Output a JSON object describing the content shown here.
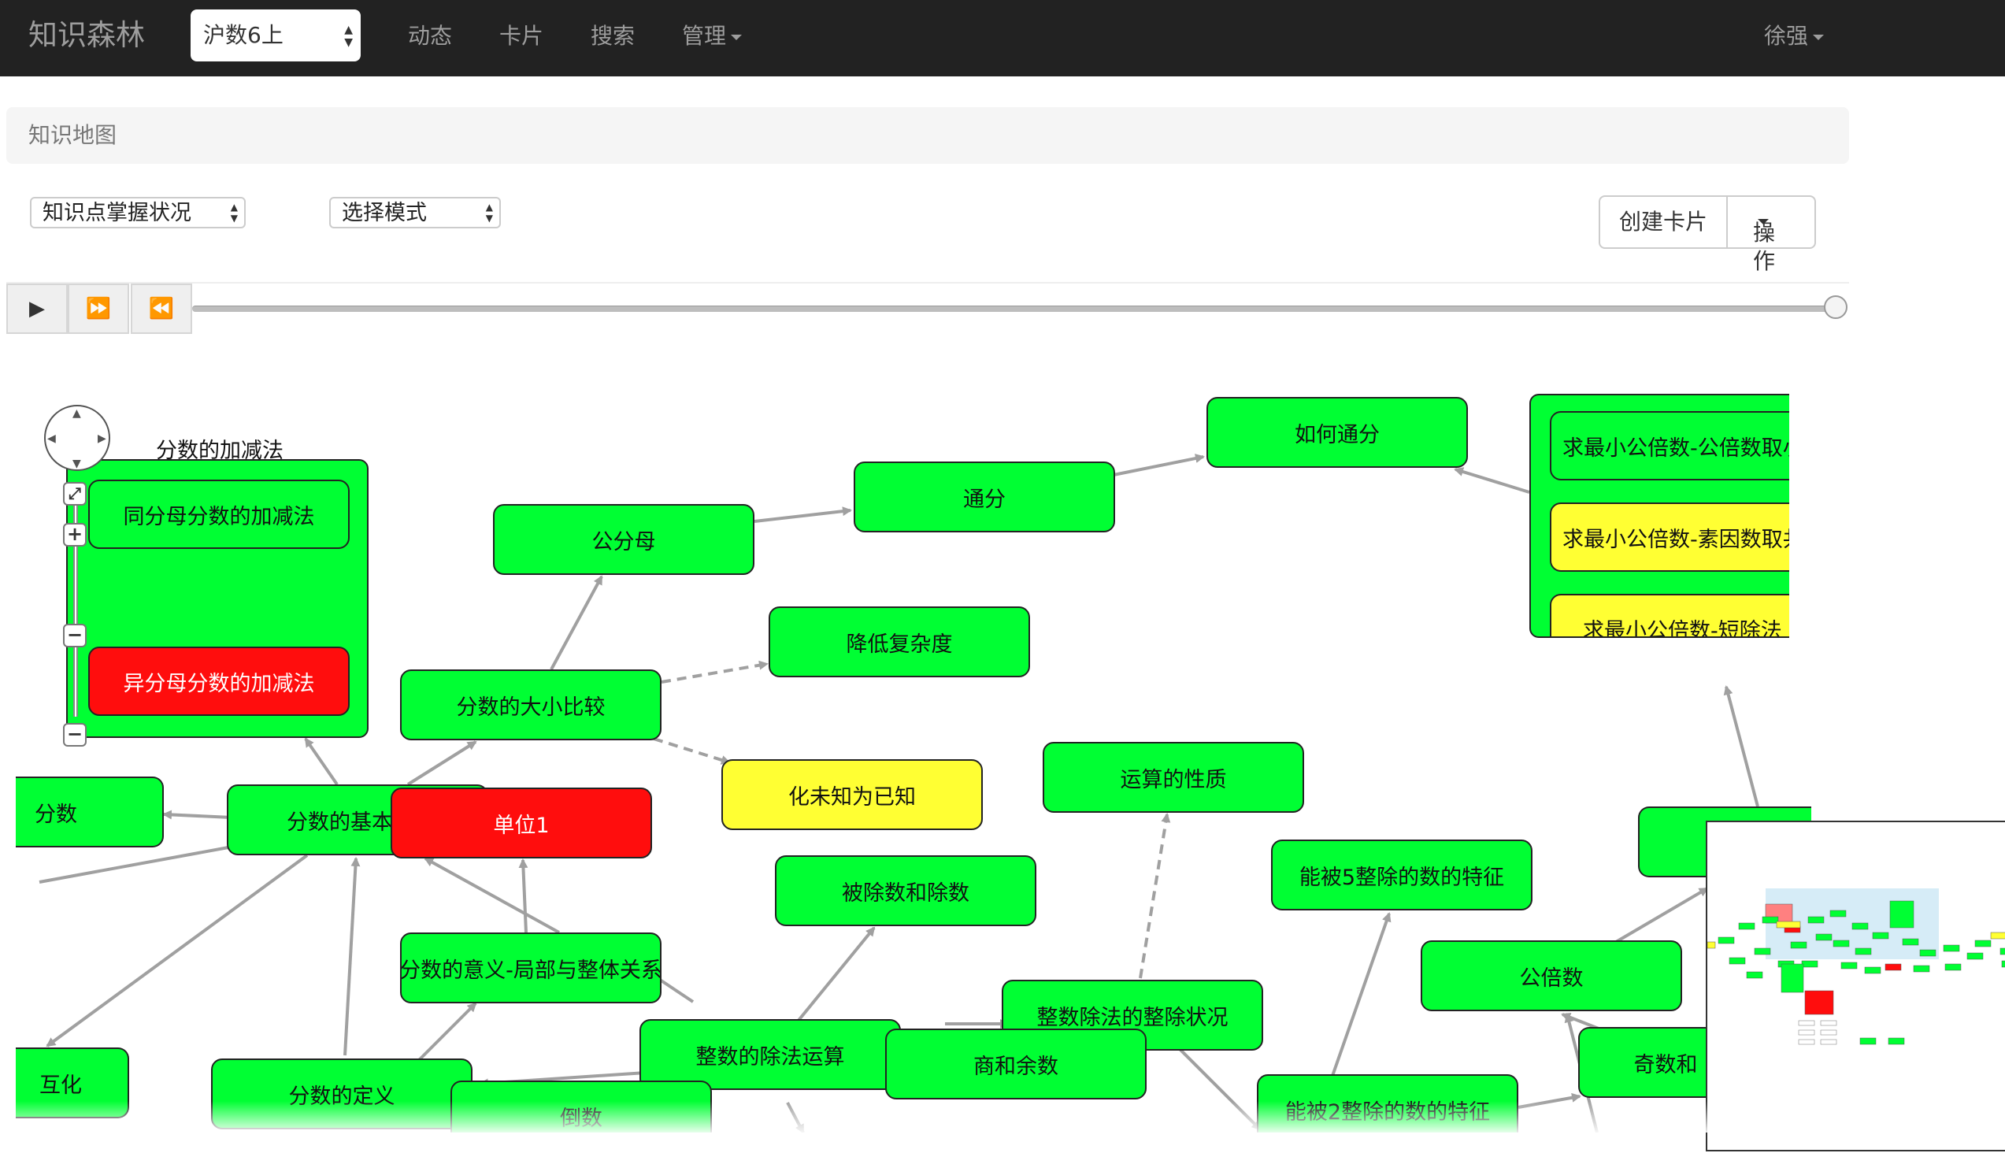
{
  "navbar": {
    "brand": "知识森林",
    "course_select": "沪数6上",
    "links": [
      "动态",
      "卡片",
      "搜索"
    ],
    "manage": "管理",
    "user": "徐强"
  },
  "breadcrumb": "知识地图",
  "controls": {
    "status_select": "知识点掌握状况",
    "mode_select": "选择模式",
    "create_card": "创建卡片",
    "actions": "操作"
  },
  "player": {
    "play_icon": "▶",
    "fast_forward_icon": "⏩",
    "rewind_icon": "⏪",
    "progress": 1.0
  },
  "colors": {
    "mastered": "#00ff33",
    "weak": "#ff0d0d",
    "partial": "#ffff33"
  },
  "graph": {
    "group_label": "分数的加减法",
    "nodes": {
      "same_denominator": "同分母分数的加减法",
      "diff_denominator": "异分母分数的加减法",
      "common_denominator": "公分母",
      "tongfen": "通分",
      "how_tongfen": "如何通分",
      "reduce_complexity": "降低复杂度",
      "compare_fractions": "分数的大小比较",
      "unknown_to_known": "化未知为已知",
      "unit_one": "单位1",
      "fraction_basic": "分数的基本",
      "fraction_left": "分数",
      "operation_props": "运算的性质",
      "dividend_divisor": "被除数和除数",
      "div_by_5": "能被5整除的数的特征",
      "fraction_meaning": "分数的意义-局部与整体关系",
      "int_division": "整数的除法运算",
      "quotient_remainder": "商和余数",
      "int_divisibility": "整数除法的整除状况",
      "common_multiple": "公倍数",
      "mutual_convert": "互化",
      "fraction_def": "分数的定义",
      "reciprocal": "倒数",
      "div_by_2": "能被2整除的数的特征",
      "odd_even": "奇数和",
      "lcm_a": "求最小公倍数-公倍数取小",
      "lcm_b": "求最小公倍数-素因数取共",
      "lcm_c": "求最小公倍数-短除法"
    }
  }
}
